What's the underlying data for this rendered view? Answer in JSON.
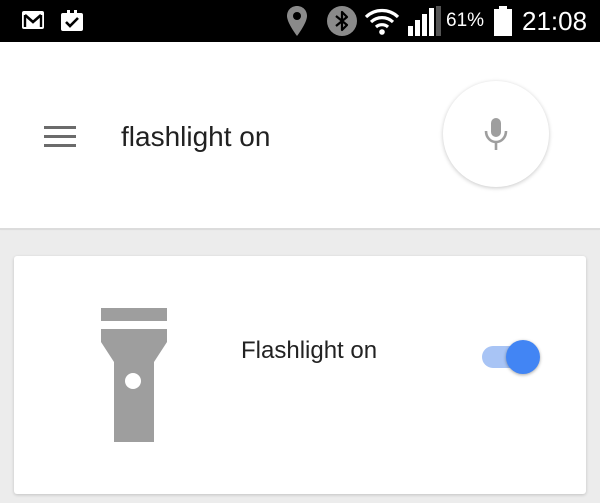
{
  "status_bar": {
    "icons": [
      "gmail-icon",
      "calendar-check-icon",
      "location-icon",
      "bluetooth-icon",
      "wifi-icon",
      "signal-icon",
      "battery-icon"
    ],
    "battery_percent": "61%",
    "time": "21:08"
  },
  "search": {
    "menu_icon": "menu-icon",
    "query": "flashlight on",
    "mic_icon": "mic-icon"
  },
  "card": {
    "icon": "flashlight-icon",
    "label": "Flashlight on",
    "toggle_on": true,
    "colors": {
      "toggle_thumb": "#4285f4",
      "toggle_track": "#a8c4f5",
      "icon": "#9e9e9e"
    }
  }
}
